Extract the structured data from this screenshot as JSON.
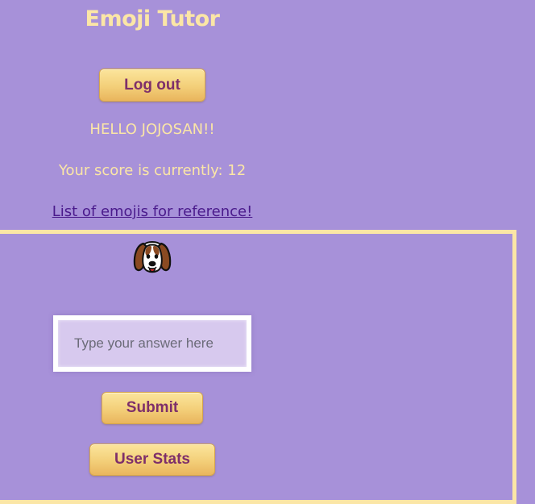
{
  "app": {
    "title": "Emoji Tutor"
  },
  "header": {
    "logout_label": "Log out",
    "greeting": "HELLO JOJOSAN!!",
    "score_text": "Your score is currently: 12",
    "reference_link": "List of emojis for reference!"
  },
  "game": {
    "emoji_icon": "dog-face-icon",
    "answer_input": {
      "value": "",
      "placeholder": "Type your answer here"
    },
    "submit_label": "Submit",
    "stats_label": "User Stats"
  },
  "colors": {
    "background": "#a791d9",
    "accent_text": "#fbe6a6",
    "button_text": "#7e2f6a",
    "link": "#4a1a8c"
  }
}
